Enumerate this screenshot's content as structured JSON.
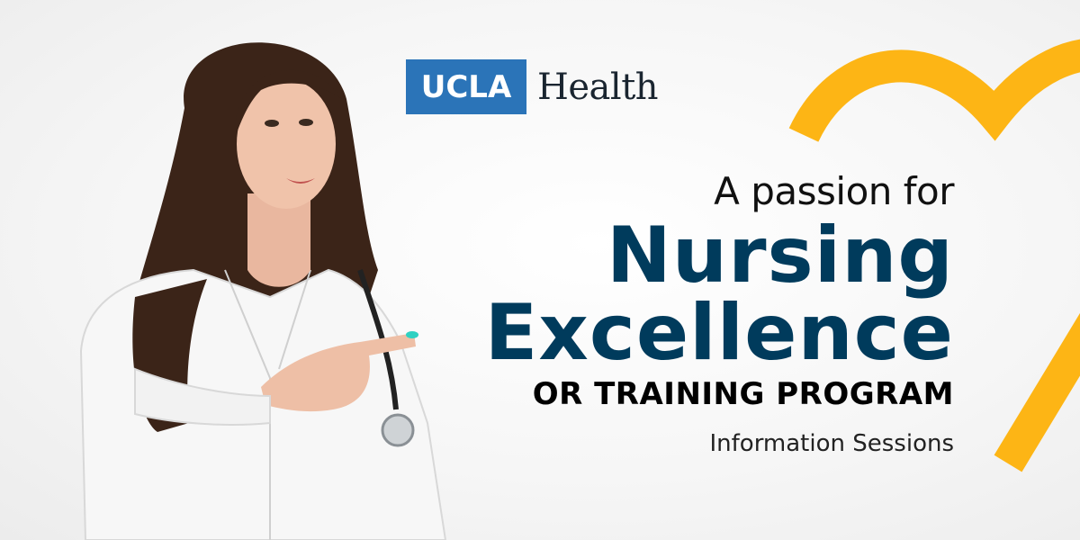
{
  "logo": {
    "box_text": "UCLA",
    "word": "Health",
    "box_color": "#2b74b8"
  },
  "headline": {
    "line1": "A passion for",
    "line2": "Nursing",
    "line3": "Excellence",
    "line4": "OR TRAINING PROGRAM",
    "line5": "Information Sessions"
  },
  "colors": {
    "navy": "#003b5c",
    "heart_gold": "#fdb515"
  }
}
